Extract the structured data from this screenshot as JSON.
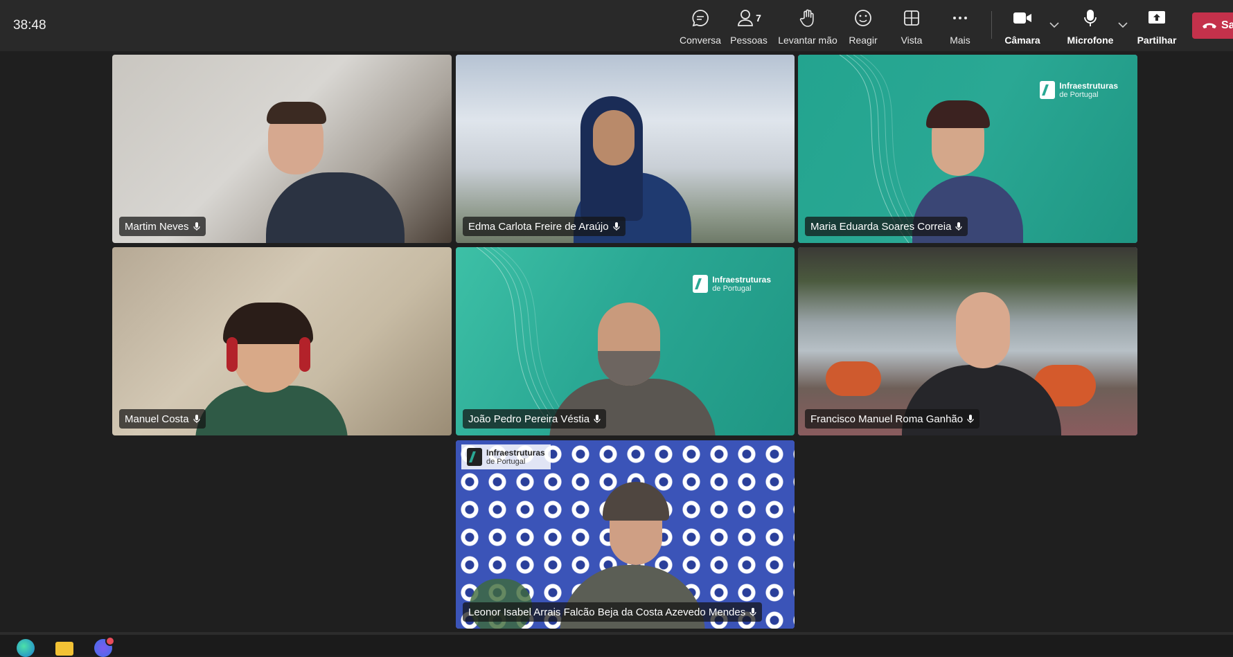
{
  "meeting": {
    "timer": "38:48",
    "people_count": "7"
  },
  "toolbar": {
    "chat": "Conversa",
    "people": "Pessoas",
    "raise_hand": "Levantar mão",
    "react": "Reagir",
    "view": "Vista",
    "more": "Mais",
    "camera": "Câmara",
    "microphone": "Microfone",
    "share": "Partilhar",
    "leave": "Sa"
  },
  "participants": [
    {
      "name": "Martim Neves",
      "speaking": false
    },
    {
      "name": "Edma Carlota Freire de Araújo",
      "speaking": true
    },
    {
      "name": "Maria Eduarda Soares Correia",
      "speaking": true
    },
    {
      "name": "Manuel Costa",
      "speaking": false
    },
    {
      "name": "João Pedro Pereira Véstia",
      "speaking": false
    },
    {
      "name": "Francisco Manuel Roma Ganhão",
      "speaking": true
    },
    {
      "name": "Leonor Isabel Arrais Falcão Beja da Costa Azevedo Mendes",
      "speaking": true
    }
  ],
  "backgrounds": {
    "logo_line1": "Infraestruturas",
    "logo_line2": "de Portugal"
  },
  "colors": {
    "speaking_outline": "#8b8ff5",
    "leave_button": "#c4314b",
    "teal_bg": "#2aa894"
  },
  "taskbar": {
    "icons": [
      "edge-icon",
      "file-explorer-icon",
      "chat-app-icon"
    ]
  }
}
